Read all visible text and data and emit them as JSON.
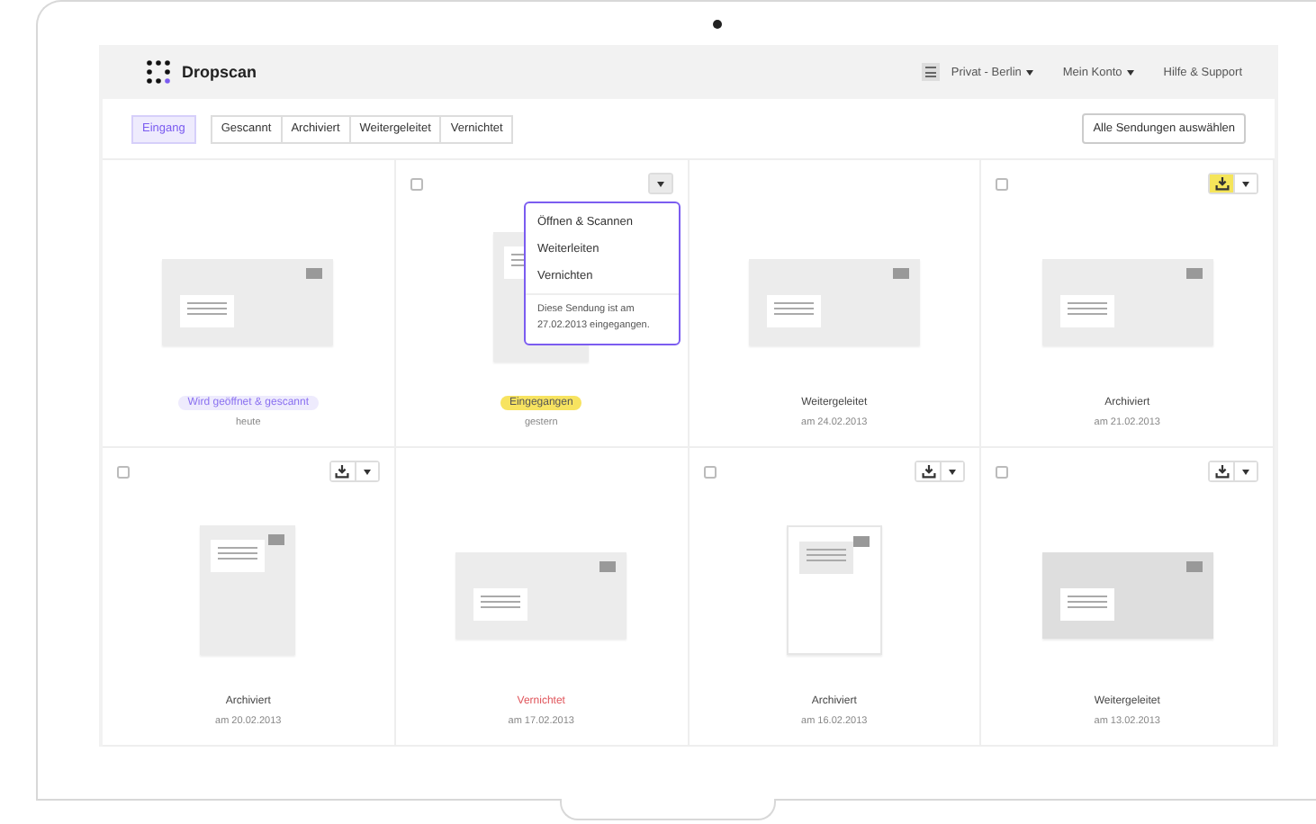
{
  "header": {
    "logo": "Dropscan",
    "nav": [
      {
        "label": "Privat - Berlin",
        "dropdown": true
      },
      {
        "label": "Mein Konto",
        "dropdown": true
      },
      {
        "label": "Hilfe & Support",
        "dropdown": false
      }
    ]
  },
  "tabs": [
    {
      "label": "Eingang",
      "selected": true
    },
    {
      "label": "Gescannt",
      "selected": false
    },
    {
      "label": "Archiviert",
      "selected": false
    },
    {
      "label": "Weitergeleitet",
      "selected": false
    },
    {
      "label": "Vernichtet",
      "selected": false
    }
  ],
  "select_all_button": "Alle Sendungen auswählen",
  "dropdown_menu": {
    "items": [
      "Öffnen & Scannen",
      "Weiterleiten",
      "Vernichten"
    ],
    "note": "Diese Sendung ist am 27.02.2013 eingegangen."
  },
  "cards": [
    {
      "kind": "landscape",
      "status": {
        "text": "Wird geöffnet & gescannt",
        "kind": "processing"
      },
      "date": "heute"
    },
    {
      "kind": "portrait",
      "checkbox": {
        "checked": false
      },
      "menu_button": {
        "open": true
      },
      "status": {
        "text": "Eingegangen",
        "kind": "received"
      },
      "date": "gestern"
    },
    {
      "kind": "landscape",
      "status": {
        "text": "Weitergeleitet",
        "kind": "plain"
      },
      "date": "am 24.02.2013"
    },
    {
      "kind": "landscape",
      "checkbox": {
        "checked": false
      },
      "download_button": {
        "highlighted": true
      },
      "menu_button": {
        "open": false
      },
      "status": {
        "text": "Archiviert",
        "kind": "plain"
      },
      "date": "am 21.02.2013"
    },
    {
      "kind": "portrait",
      "checkbox": {
        "checked": false
      },
      "download_button": {
        "highlighted": false
      },
      "menu_button": {
        "open": false
      },
      "status": {
        "text": "Archiviert",
        "kind": "plain"
      },
      "date": "am 20.02.2013"
    },
    {
      "kind": "landscape",
      "status": {
        "text": "Vernichtet",
        "kind": "destroyed"
      },
      "date": "am 17.02.2013"
    },
    {
      "kind": "sheet",
      "checkbox": {
        "checked": false
      },
      "download_button": {
        "highlighted": false
      },
      "menu_button": {
        "open": false
      },
      "status": {
        "text": "Archiviert",
        "kind": "plain"
      },
      "date": "am 16.02.2013"
    },
    {
      "kind": "grey",
      "checkbox": {
        "checked": false
      },
      "download_button": {
        "highlighted": false
      },
      "menu_button": {
        "open": false
      },
      "status": {
        "text": "Weitergeleitet",
        "kind": "plain"
      },
      "date": "am 13.02.2013"
    }
  ]
}
